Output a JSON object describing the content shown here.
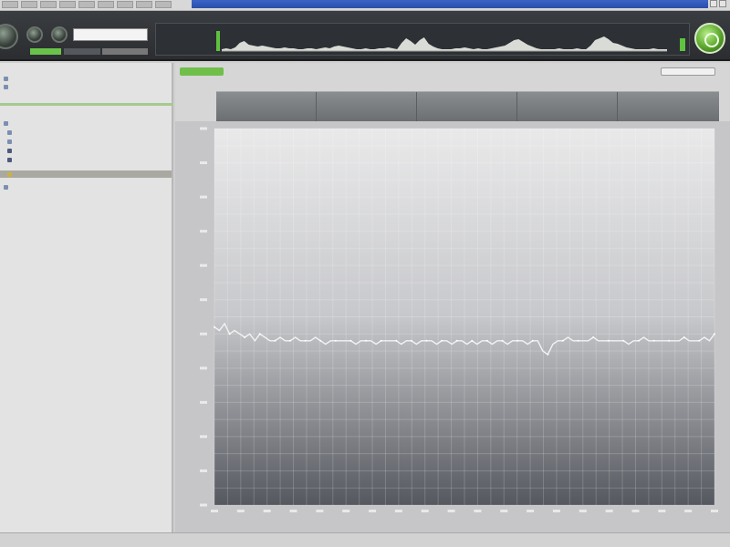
{
  "toolbar": {
    "search_value": "",
    "wave_profile": [
      2,
      3,
      2,
      4,
      9,
      11,
      7,
      6,
      5,
      6,
      5,
      4,
      3,
      3,
      4,
      3,
      3,
      2,
      2,
      3,
      3,
      2,
      3,
      4,
      3,
      5,
      6,
      5,
      4,
      3,
      2,
      2,
      3,
      2,
      2,
      3,
      3,
      4,
      3,
      2,
      9,
      14,
      11,
      7,
      12,
      15,
      8,
      5,
      3,
      2,
      2,
      2,
      3,
      3,
      4,
      3,
      2,
      3,
      2,
      2,
      3,
      4,
      5,
      6,
      9,
      12,
      13,
      10,
      7,
      5,
      3,
      2,
      2,
      2,
      2,
      3,
      2,
      2,
      2,
      3,
      2,
      2,
      6,
      12,
      14,
      16,
      13,
      9,
      8,
      6,
      4,
      3,
      2,
      2,
      2,
      2,
      3,
      2,
      2,
      2
    ]
  },
  "sidebar": {
    "section1_header": "",
    "section1_rows": [
      "",
      ""
    ],
    "section2_header": "",
    "section2_rows": [
      "",
      "",
      "",
      "",
      "",
      "",
      ""
    ]
  },
  "main": {
    "tab_label": "",
    "tab_caption": "",
    "columns": [
      {
        "l1": "",
        "l2": "",
        "l3": ""
      },
      {
        "l1": "",
        "l2": "",
        "l3": ""
      },
      {
        "l1": "",
        "l2": "",
        "l3": ""
      },
      {
        "l1": "",
        "l2": "",
        "l3": ""
      },
      {
        "l1": "",
        "l2": "",
        "l3": ""
      }
    ]
  },
  "chart_data": {
    "type": "line",
    "title": "",
    "xlabel": "",
    "ylabel": "",
    "ylim": [
      0,
      11
    ],
    "xlim": [
      0,
      100
    ],
    "grid": true,
    "series": [
      {
        "values": [
          5.2,
          5.1,
          5.3,
          5.0,
          5.1,
          5.0,
          4.9,
          5.0,
          4.8,
          5.0,
          4.9,
          4.8,
          4.8,
          4.9,
          4.8,
          4.8,
          4.9,
          4.8,
          4.8,
          4.8,
          4.9,
          4.8,
          4.7,
          4.8,
          4.8,
          4.8,
          4.8,
          4.8,
          4.7,
          4.8,
          4.8,
          4.8,
          4.7,
          4.8,
          4.8,
          4.8,
          4.8,
          4.7,
          4.8,
          4.8,
          4.7,
          4.8,
          4.8,
          4.8,
          4.7,
          4.8,
          4.8,
          4.7,
          4.8,
          4.8,
          4.7,
          4.8,
          4.7,
          4.8,
          4.8,
          4.7,
          4.8,
          4.8,
          4.7,
          4.8,
          4.8,
          4.8,
          4.7,
          4.8,
          4.8,
          4.5,
          4.4,
          4.7,
          4.8,
          4.8,
          4.9,
          4.8,
          4.8,
          4.8,
          4.8,
          4.9,
          4.8,
          4.8,
          4.8,
          4.8,
          4.8,
          4.8,
          4.7,
          4.8,
          4.8,
          4.9,
          4.8,
          4.8,
          4.8,
          4.8,
          4.8,
          4.8,
          4.8,
          4.9,
          4.8,
          4.8,
          4.8,
          4.9,
          4.8,
          5.0
        ]
      }
    ]
  }
}
